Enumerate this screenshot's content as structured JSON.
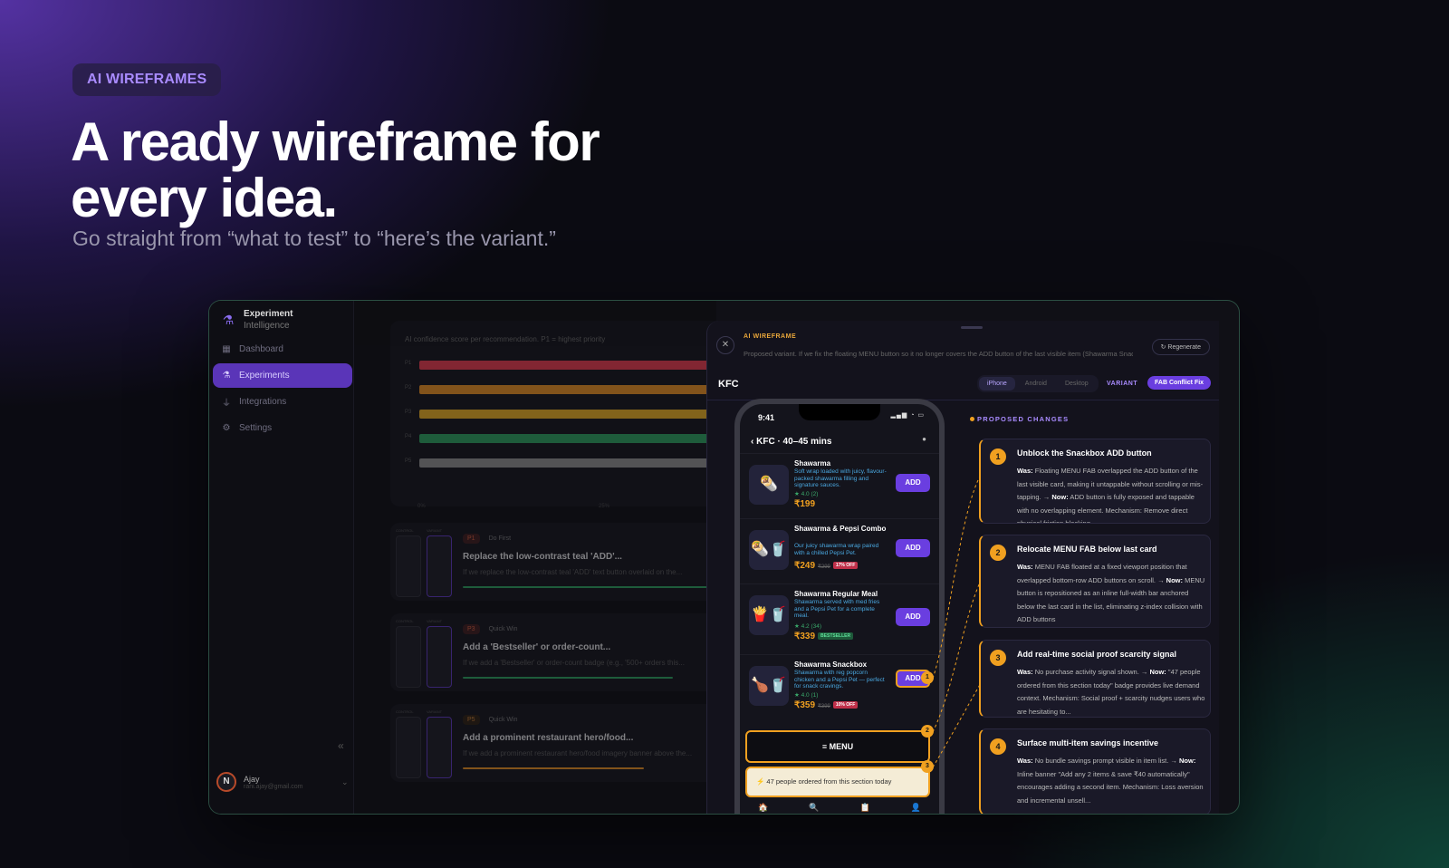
{
  "hero": {
    "badge": "AI WIREFRAMES",
    "title": "A ready wireframe for every idea.",
    "subtitle": "Go straight from “what to test” to “here’s the variant.”"
  },
  "sidebar": {
    "brand_line1": "Experiment",
    "brand_line2": "Intelligence",
    "items": [
      {
        "label": "Dashboard",
        "icon": "grid-icon"
      },
      {
        "label": "Experiments",
        "icon": "flask-icon",
        "active": true
      },
      {
        "label": "Integrations",
        "icon": "plug-icon"
      },
      {
        "label": "Settings",
        "icon": "gear-icon"
      }
    ],
    "collapse": "«",
    "user": {
      "initial": "N",
      "name": "Ajay",
      "email": "rani.ajay@gmail.com"
    }
  },
  "main": {
    "chart_subtitle": "AI confidence score per recommendation. P1 = highest priority",
    "chart_data": {
      "type": "bar",
      "categories": [
        "P1",
        "P2",
        "P3",
        "P4",
        "P5"
      ],
      "colors": [
        "#e0384a",
        "#e08a20",
        "#e0a820",
        "#2a9a5a",
        "#8a8a8a"
      ],
      "axis_ticks": [
        "0%",
        "25%"
      ]
    },
    "recommendations": [
      {
        "priority": "P1",
        "category": "Do First",
        "title": "Replace the low-contrast teal 'ADD'...",
        "desc": "If we replace the low-contrast teal 'ADD' text button overlaid on the...",
        "thumb_control": "CONTROL",
        "thumb_variant": "VARIANT",
        "bar_color": "#2a9a5a"
      },
      {
        "priority": "P3",
        "category": "Quick Win",
        "title": "Add a 'Bestseller' or order-count...",
        "desc": "If we add a 'Bestseller' or order-count badge (e.g., '500+ orders this...",
        "thumb_control": "CONTROL",
        "thumb_variant": "VARIANT",
        "bar_color": "#2a9a5a"
      },
      {
        "priority": "P5",
        "category": "Quick Win",
        "title": "Add a prominent restaurant hero/food...",
        "desc": "If we add a prominent restaurant hero/food imagery banner above the...",
        "thumb_control": "CONTROL",
        "thumb_variant": "VARIANT",
        "bar_color": "#e08a20"
      }
    ]
  },
  "panel": {
    "label": "AI WIREFRAME",
    "description": "Proposed variant. If we fix the floating MENU button so it no longer covers the ADD button of the last visible item (Shawarma Snack...",
    "regenerate": "Regenerate",
    "store": "KFC",
    "device_tabs": [
      "iPhone",
      "Android",
      "Desktop"
    ],
    "variant_label": "VARIANT",
    "variant_name": "FAB Conflict Fix"
  },
  "phone": {
    "time": "9:41",
    "header": "KFC · 40–45 mins",
    "items": [
      {
        "name": "Shawarma",
        "desc": "Soft wrap loaded with juicy, flavour-packed shawarma filling and signature sauces.",
        "rating": "★ 4.0 (2)",
        "price": "₹199",
        "old": "",
        "badge": "",
        "icon": "🌯",
        "add": "ADD"
      },
      {
        "name": "Shawarma & Pepsi Combo",
        "desc": "Our juicy shawarma wrap paired with a chilled Pepsi Pet.",
        "rating": "",
        "price": "₹249",
        "old": "₹299",
        "badge": "17% OFF",
        "badge_type": "off",
        "icon": "🌯🥤",
        "add": "ADD"
      },
      {
        "name": "Shawarma Regular Meal",
        "desc": "Shawarma served with med fries and a Pepsi Pet for a complete meal.",
        "rating": "★ 4.2 (34)",
        "price": "₹339",
        "old": "",
        "badge": "BESTSELLER",
        "badge_type": "best",
        "icon": "🍟🥤",
        "add": "ADD"
      },
      {
        "name": "Shawarma Snackbox",
        "desc": "Shawarma with reg popcorn chicken and a Pepsi Pet — perfect for snack cravings.",
        "rating": "★ 4.0 (1)",
        "price": "₹359",
        "old": "₹399",
        "badge": "10% OFF",
        "badge_type": "off",
        "icon": "🍗🥤",
        "add": "ADD"
      }
    ],
    "menu": "≡  MENU",
    "social_proof": "⚡  47 people ordered from this section today",
    "tabs": [
      "🏠",
      "🔍",
      "📋",
      "👤"
    ],
    "markers": [
      "1",
      "2",
      "3"
    ]
  },
  "changes": {
    "title": "PROPOSED CHANGES",
    "items": [
      {
        "num": "1",
        "title": "Unblock the Snackbox ADD button",
        "was_label": "Was:",
        "was": "Floating MENU FAB overlapped the ADD button of the last visible card, making it untappable without scrolling or mis-tapping. →",
        "now_label": "Now:",
        "now": "ADD button is fully exposed and tappable with no overlapping element. Mechanism: Remove direct physical friction blocking..."
      },
      {
        "num": "2",
        "title": "Relocate MENU FAB below last card",
        "was_label": "Was:",
        "was": "MENU FAB floated at a fixed viewport position that overlapped bottom-row ADD buttons on scroll. →",
        "now_label": "Now:",
        "now": "MENU button is repositioned as an inline full-width bar anchored below the last card in the list, eliminating z-index collision with ADD buttons"
      },
      {
        "num": "3",
        "title": "Add real-time social proof scarcity signal",
        "was_label": "Was:",
        "was": "No purchase activity signal shown. →",
        "now_label": "Now:",
        "now": "\"47 people ordered from this section today\" badge provides live demand context. Mechanism: Social proof + scarcity nudges users who are hesitating to..."
      },
      {
        "num": "4",
        "title": "Surface multi-item savings incentive",
        "was_label": "Was:",
        "was": "No bundle savings prompt visible in item list. →",
        "now_label": "Now:",
        "now": "Inline banner \"Add any 2 items & save ₹40 automatically\" encourages adding a second item. Mechanism: Loss aversion and incremental unsell..."
      }
    ]
  }
}
